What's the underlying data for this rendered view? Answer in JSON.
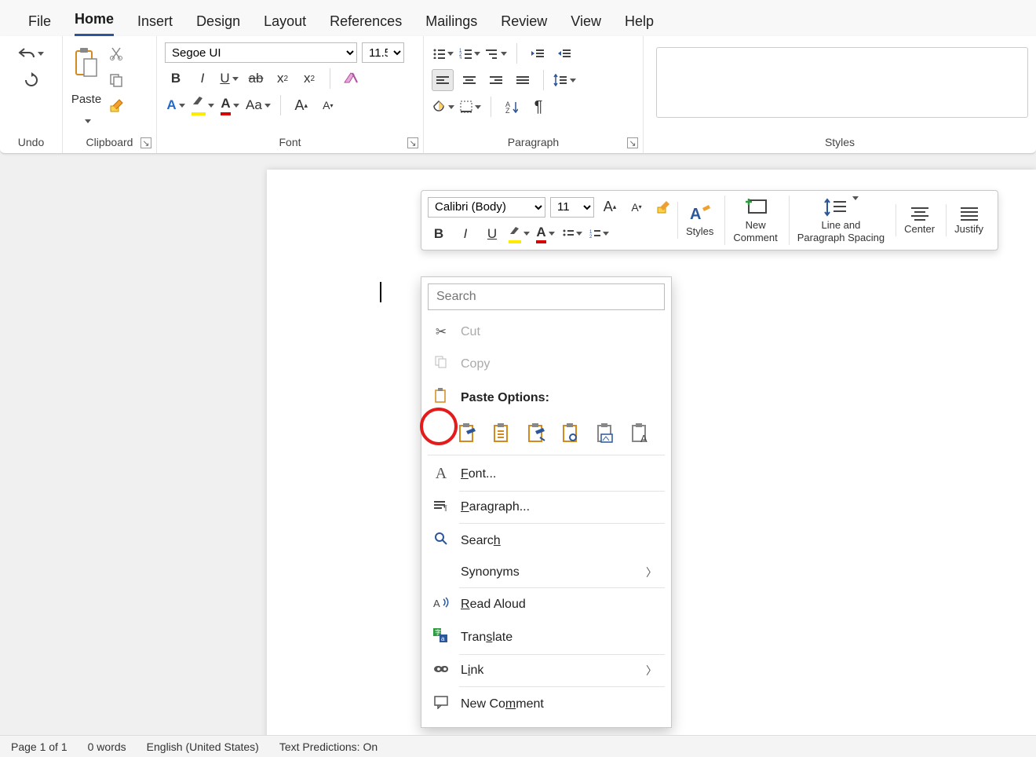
{
  "tabs": [
    "File",
    "Home",
    "Insert",
    "Design",
    "Layout",
    "References",
    "Mailings",
    "Review",
    "View",
    "Help"
  ],
  "active_tab": "Home",
  "ribbon": {
    "undo": {
      "label": "Undo"
    },
    "clipboard": {
      "label": "Clipboard",
      "paste": "Paste"
    },
    "font": {
      "label": "Font",
      "font_name": "Segoe UI",
      "font_size": "11.5"
    },
    "paragraph": {
      "label": "Paragraph"
    },
    "styles": {
      "label": "Styles"
    }
  },
  "minitb": {
    "font_name": "Calibri (Body)",
    "font_size": "11",
    "styles": "Styles",
    "new_comment": "New\nComment",
    "line_spacing": "Line and\nParagraph Spacing",
    "center": "Center",
    "justify": "Justify"
  },
  "context_menu": {
    "search_placeholder": "Search",
    "cut": "Cut",
    "copy": "Copy",
    "paste_options": "Paste Options:",
    "font": "Font...",
    "paragraph": "Paragraph...",
    "search": "Search",
    "synonyms": "Synonyms",
    "read_aloud": "Read Aloud",
    "translate": "Translate",
    "link": "Link",
    "new_comment": "New Comment"
  },
  "statusbar": {
    "page": "Page 1 of 1",
    "words": "0 words",
    "lang": "English (United States)",
    "predictions": "Text Predictions: On"
  }
}
